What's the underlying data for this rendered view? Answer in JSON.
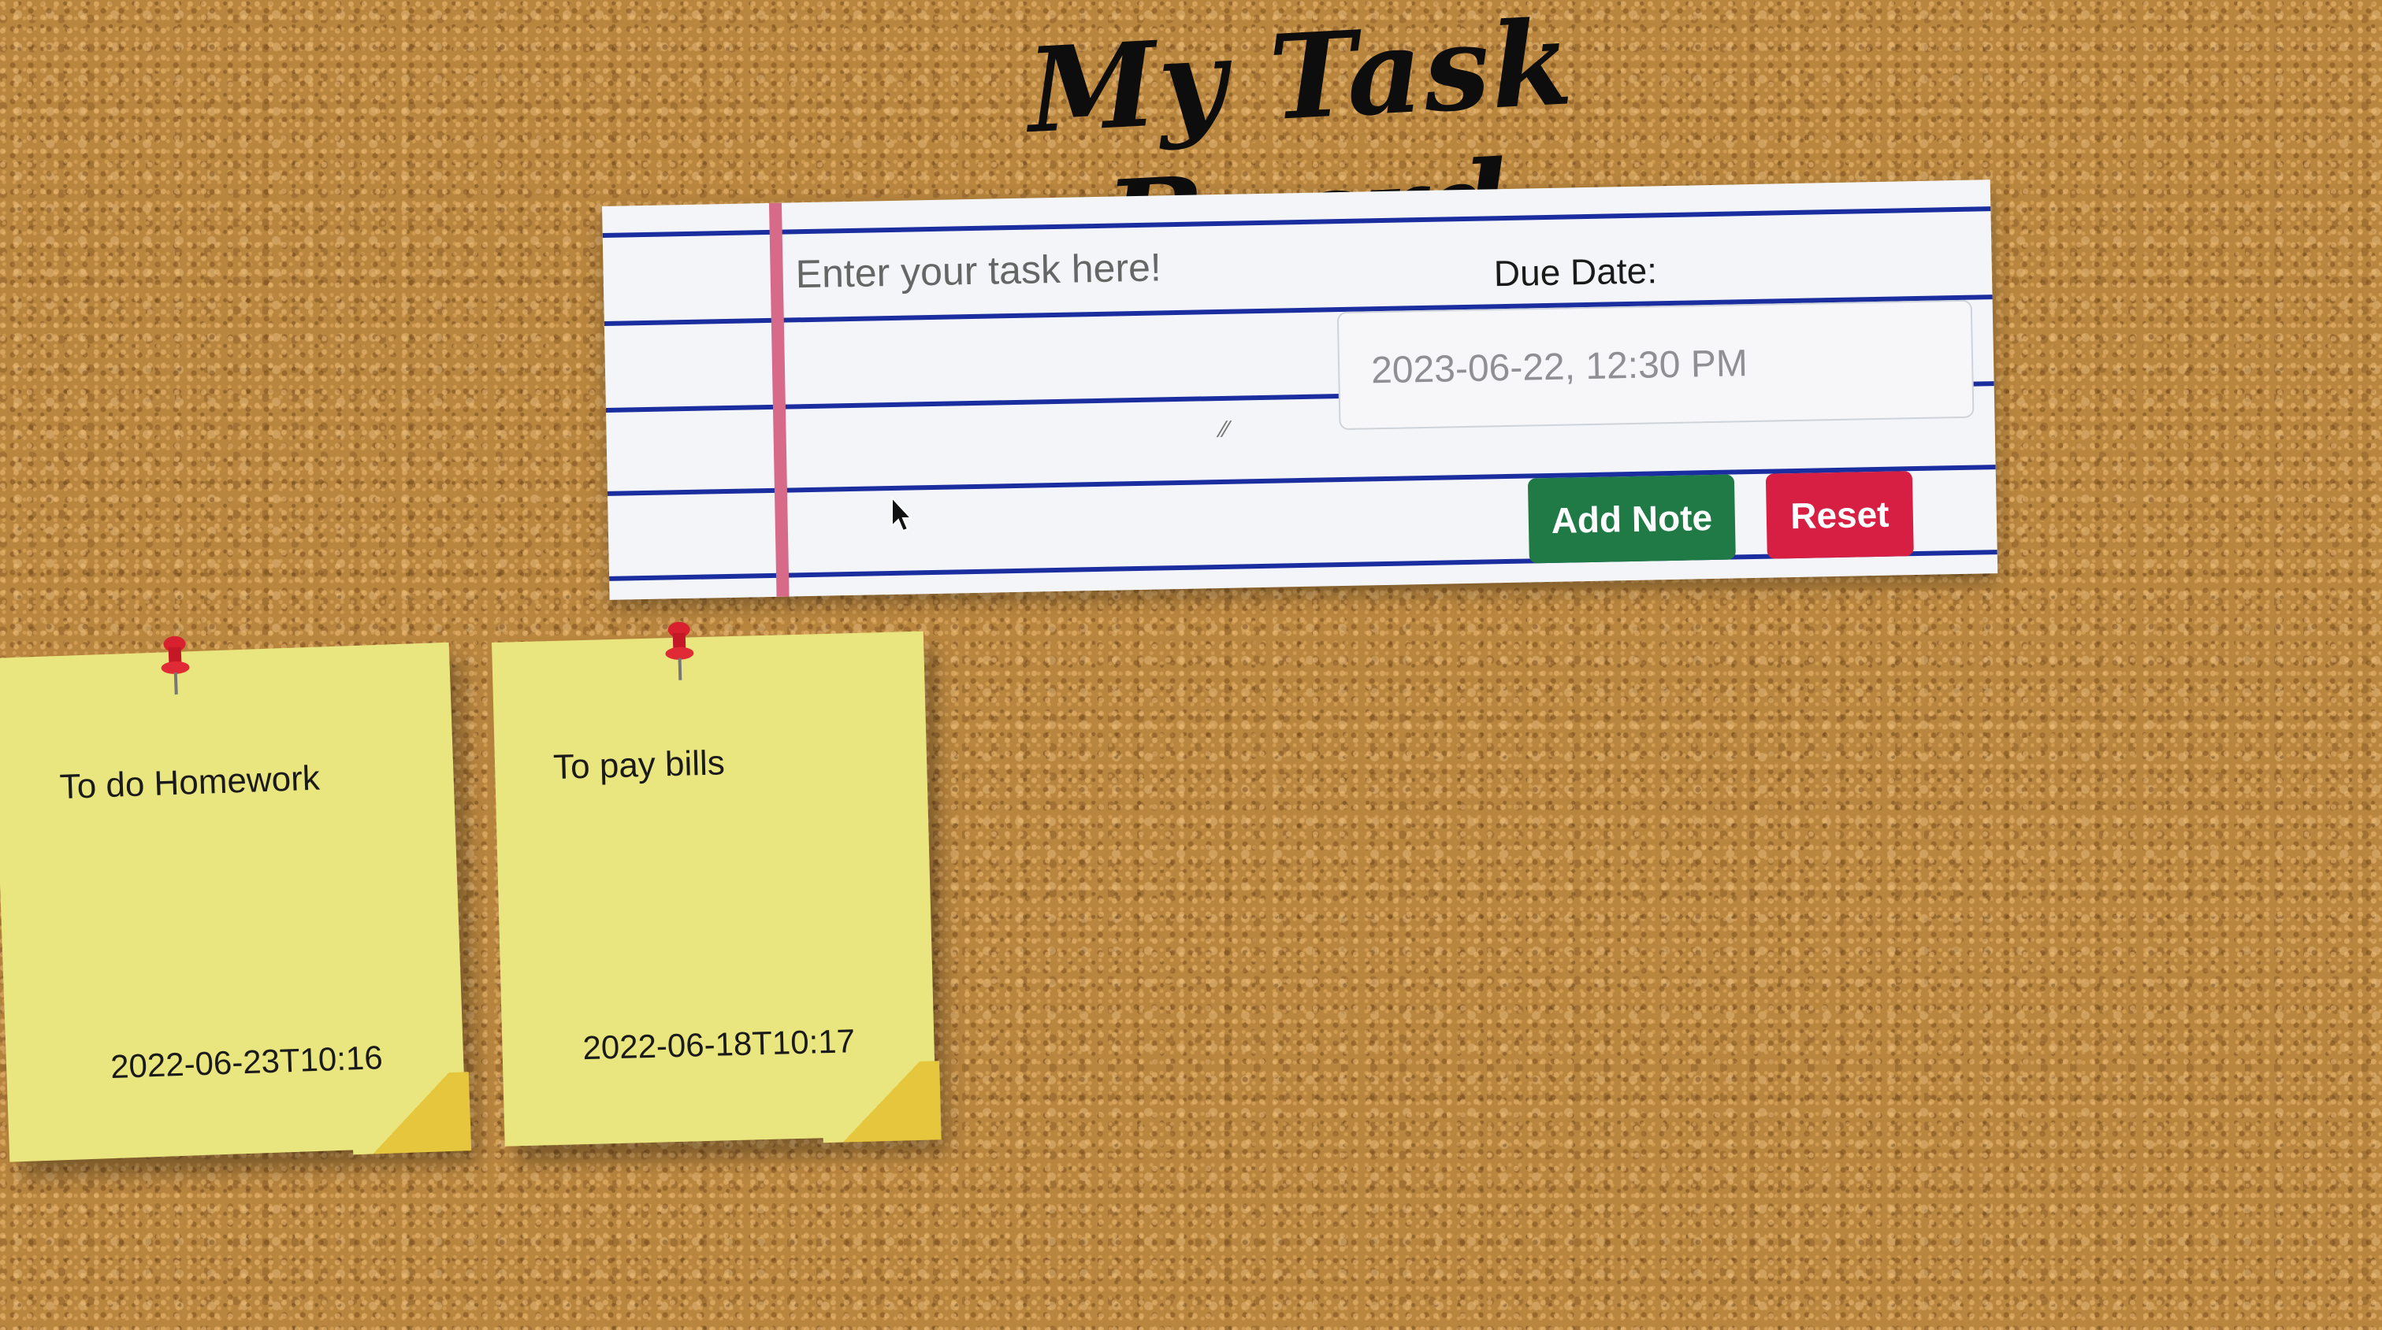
{
  "board": {
    "title": "My Task Board"
  },
  "form": {
    "task_placeholder": "Enter your task here!",
    "due_label": "Due Date:",
    "due_value": "2023-06-22, 12:30 PM",
    "add_button": "Add Note",
    "reset_button": "Reset"
  },
  "notes": [
    {
      "text": "To do Homework",
      "date": "2022-06-23T10:16"
    },
    {
      "text": "To pay bills",
      "date": "2022-06-18T10:17"
    }
  ],
  "colors": {
    "note": "#e9e57f",
    "add_button": "#1f7a45",
    "reset_button": "#d71f44",
    "paper_rule": "#1b2ea0",
    "paper_margin": "#d66a88"
  },
  "icons": [
    "pushpin-icon",
    "cursor-icon",
    "resize-grip-icon"
  ]
}
